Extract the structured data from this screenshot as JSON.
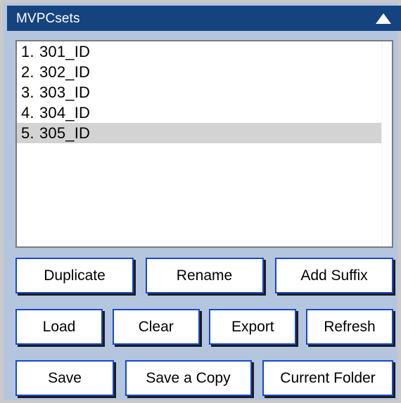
{
  "window": {
    "title": "MVPCsets",
    "collapse_icon": "triangle-up-icon",
    "title_bar_color": "#154380",
    "panel_background": "#b4c5de",
    "accent_color": "#1449cf"
  },
  "list": {
    "selection_color": "#d3d3d3",
    "selected_index": 5,
    "items": [
      {
        "index": "1.",
        "label": "301_ID",
        "selected": false
      },
      {
        "index": "2.",
        "label": "302_ID",
        "selected": false
      },
      {
        "index": "3.",
        "label": "303_ID",
        "selected": false
      },
      {
        "index": "4.",
        "label": "304_ID",
        "selected": false
      },
      {
        "index": "5.",
        "label": "305_ID",
        "selected": true
      }
    ]
  },
  "buttons": {
    "row1": [
      {
        "id": "duplicate",
        "label": "Duplicate"
      },
      {
        "id": "rename",
        "label": "Rename"
      },
      {
        "id": "add-suffix",
        "label": "Add Suffix"
      }
    ],
    "row2": [
      {
        "id": "load",
        "label": "Load"
      },
      {
        "id": "clear",
        "label": "Clear"
      },
      {
        "id": "export",
        "label": "Export"
      },
      {
        "id": "refresh",
        "label": "Refresh"
      }
    ],
    "row3": [
      {
        "id": "save",
        "label": "Save"
      },
      {
        "id": "save-a-copy",
        "label": "Save a Copy"
      },
      {
        "id": "current-folder",
        "label": "Current Folder"
      }
    ]
  }
}
